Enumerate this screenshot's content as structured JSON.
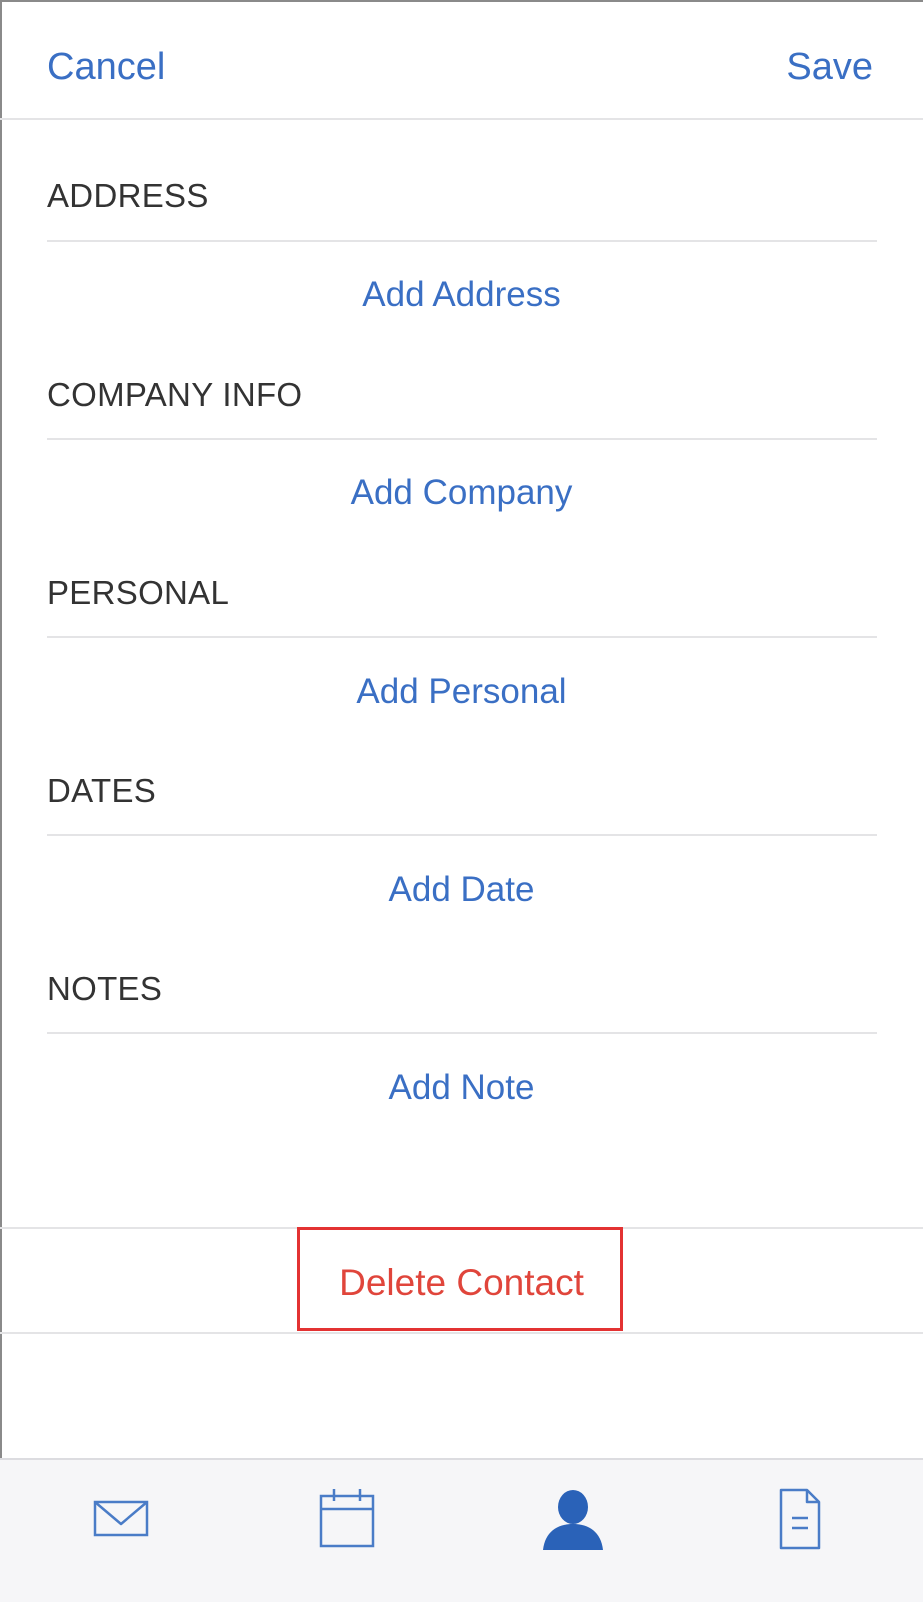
{
  "navbar": {
    "cancel_label": "Cancel",
    "save_label": "Save"
  },
  "sections": [
    {
      "header": "ADDRESS",
      "action": "Add Address"
    },
    {
      "header": "COMPANY INFO",
      "action": "Add Company"
    },
    {
      "header": "PERSONAL",
      "action": "Add Personal"
    },
    {
      "header": "DATES",
      "action": "Add Date"
    },
    {
      "header": "NOTES",
      "action": "Add Note"
    }
  ],
  "delete_label": "Delete Contact",
  "tabbar": {
    "tabs": [
      {
        "icon": "mail-icon",
        "active": false
      },
      {
        "icon": "calendar-icon",
        "active": false
      },
      {
        "icon": "contact-person-icon",
        "active": true
      },
      {
        "icon": "document-icon",
        "active": false
      }
    ]
  },
  "colors": {
    "accent": "#3a6fc4",
    "destructive": "#e0453b",
    "highlight_box": "#e33232",
    "tab_active": "#2a62b8",
    "tab_inactive": "#4a7cc7"
  }
}
